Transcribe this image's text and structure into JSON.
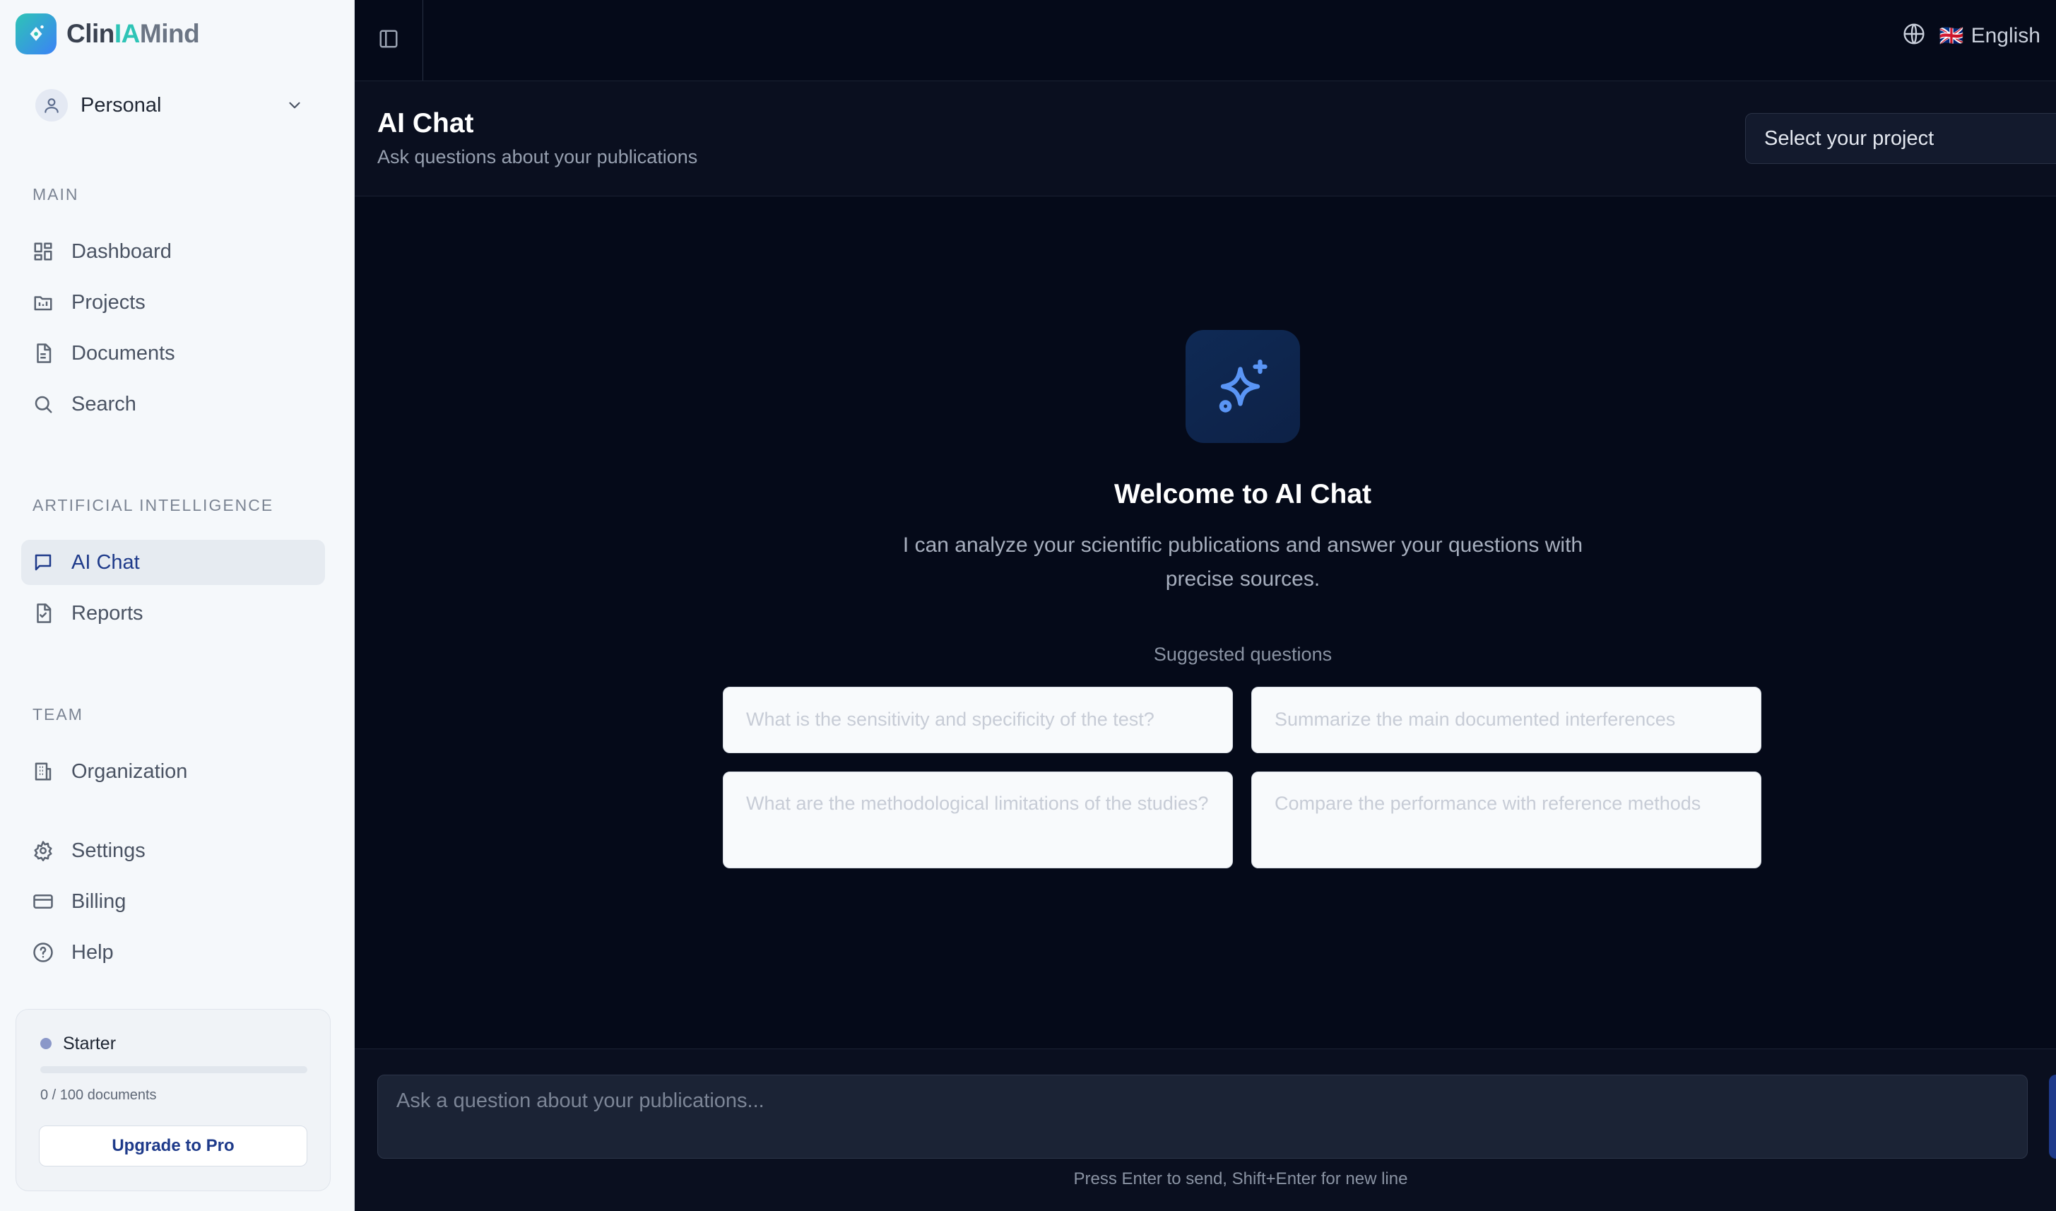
{
  "app": {
    "logo_part1": "Clin",
    "logo_part2": "IA",
    "logo_part3": "Mind"
  },
  "workspace": {
    "label": "Personal"
  },
  "sidebar": {
    "sections": {
      "main": "MAIN",
      "ai": "ARTIFICIAL INTELLIGENCE",
      "team": "TEAM"
    },
    "items": {
      "dashboard": "Dashboard",
      "projects": "Projects",
      "documents": "Documents",
      "search": "Search",
      "ai_chat": "AI Chat",
      "reports": "Reports",
      "organization": "Organization",
      "settings": "Settings",
      "billing": "Billing",
      "help": "Help"
    },
    "active": "ai_chat"
  },
  "plan": {
    "name": "Starter",
    "count_text": "0 / 100 documents",
    "usage_fraction": 0,
    "upgrade_label": "Upgrade to Pro"
  },
  "topbar": {
    "language_flag": "🇬🇧",
    "language": "English"
  },
  "header": {
    "title": "AI Chat",
    "subtitle": "Ask questions about your publications",
    "project_placeholder": "Select your project"
  },
  "welcome": {
    "title": "Welcome to AI Chat",
    "description": "I can analyze your scientific publications and answer your questions with precise sources.",
    "suggested_label": "Suggested questions",
    "questions": [
      "What is the sensitivity and specificity of the test?",
      "Summarize the main documented interferences",
      "What are the methodological limitations of the studies?",
      "Compare the performance with reference methods"
    ]
  },
  "composer": {
    "placeholder": "Ask a question about your publications...",
    "hint": "Press Enter to send, Shift+Enter for new line"
  },
  "colors": {
    "accent": "#3b82f6",
    "active_nav_text": "#1e3a8a",
    "sidebar_bg": "#f5f8fb",
    "main_bg": "#050a19"
  }
}
